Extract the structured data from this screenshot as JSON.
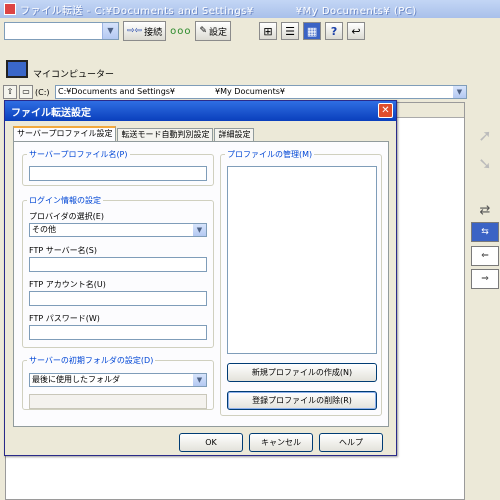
{
  "app": {
    "title": "ファイル転送 - C:¥Documents and Settings¥　　　　¥My Documents¥ (PC)"
  },
  "toolbar": {
    "connect_label": "接続",
    "settings_label": "設定",
    "status_dots": "ooo"
  },
  "explorer": {
    "pc_label": "マイコンピューター",
    "drive_label": "(C:)",
    "path": "C:¥Documents and Settings¥　　　　　¥My Documents¥"
  },
  "dialog": {
    "title": "ファイル転送設定",
    "close_glyph": "✕",
    "tabs": [
      {
        "label": "サーバープロファイル設定"
      },
      {
        "label": "転送モード自動判別設定"
      },
      {
        "label": "詳細設定"
      }
    ],
    "profile_name_group": "サーバープロファイル名(P)",
    "profile_name_value": "",
    "login_group": "ログイン情報の設定",
    "provider_label": "プロバイダの選択(E)",
    "provider_value": "その他",
    "ftp_server_label": "FTP サーバー名(S)",
    "ftp_server_value": "",
    "ftp_account_label": "FTP アカウント名(U)",
    "ftp_account_value": "",
    "ftp_password_label": "FTP パスワード(W)",
    "ftp_password_value": "",
    "init_folder_group": "サーバーの初期フォルダの設定(D)",
    "init_folder_value": "最後に使用したフォルダ",
    "init_folder_path": "",
    "manage_group": "プロファイルの管理(M)",
    "new_profile_button": "新規プロファイルの作成(N)",
    "delete_profile_button": "登録プロファイルの削除(R)",
    "ok_button": "OK",
    "cancel_button": "キャンセル",
    "help_button": "ヘルプ"
  },
  "colors": {
    "dialog_title": "#0a3fbc",
    "accent_group_text": "#0046d5",
    "active_tab_highlight": "#f2a93c",
    "selected_tool": "#3b63c5"
  }
}
